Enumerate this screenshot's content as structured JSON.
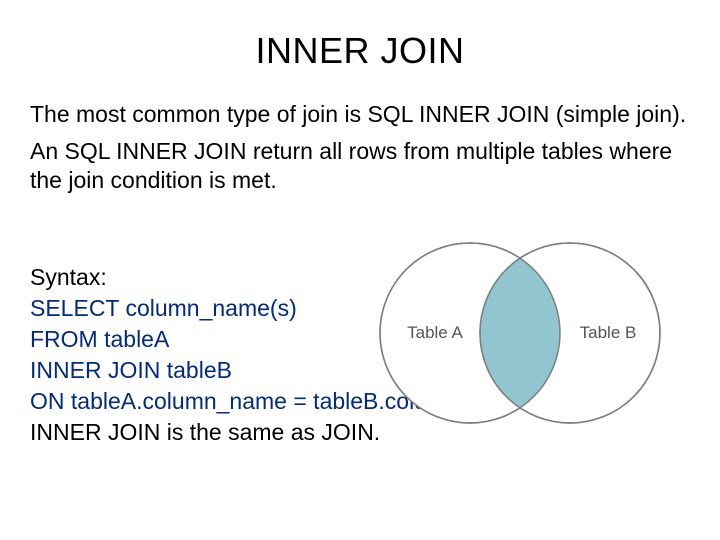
{
  "title": "INNER JOIN",
  "paragraph1": "The most common type of join is SQL INNER JOIN (simple join).",
  "paragraph2": "An SQL INNER JOIN return all rows from multiple tables where the join condition is met.",
  "syntax_label": "Syntax:",
  "syntax_lines": {
    "l1": "SELECT column_name(s)",
    "l2": "FROM tableA",
    "l3": "INNER JOIN tableB",
    "l4": "ON tableA.column_name = tableB.column_name;"
  },
  "note": "INNER JOIN is the same as JOIN.",
  "venn": {
    "left_label": "Table A",
    "right_label": "Table B",
    "fill_color": "#91c6d1",
    "stroke_color": "#7d7d7d",
    "text_color": "#565656"
  }
}
